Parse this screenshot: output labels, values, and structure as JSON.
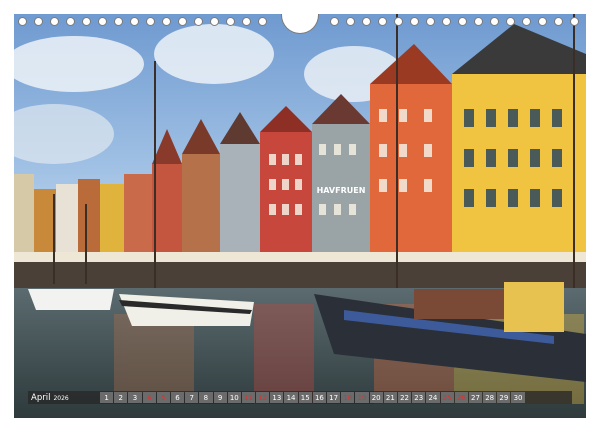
{
  "calendar": {
    "month": "April",
    "year": "2026",
    "days": [
      "1",
      "2",
      "3",
      "4",
      "5",
      "6",
      "7",
      "8",
      "9",
      "10",
      "11",
      "12",
      "13",
      "14",
      "15",
      "16",
      "17",
      "18",
      "19",
      "20",
      "21",
      "22",
      "23",
      "24",
      "25",
      "26",
      "27",
      "28",
      "29",
      "30"
    ],
    "weekend_days": [
      "4",
      "5",
      "11",
      "12",
      "18",
      "19",
      "25",
      "26"
    ],
    "colors": {
      "strip": "#282828",
      "day_box": "#6b6b6b",
      "weekend_text": "#e03030"
    }
  },
  "photo": {
    "sign_text": "HAVFRUEN"
  }
}
